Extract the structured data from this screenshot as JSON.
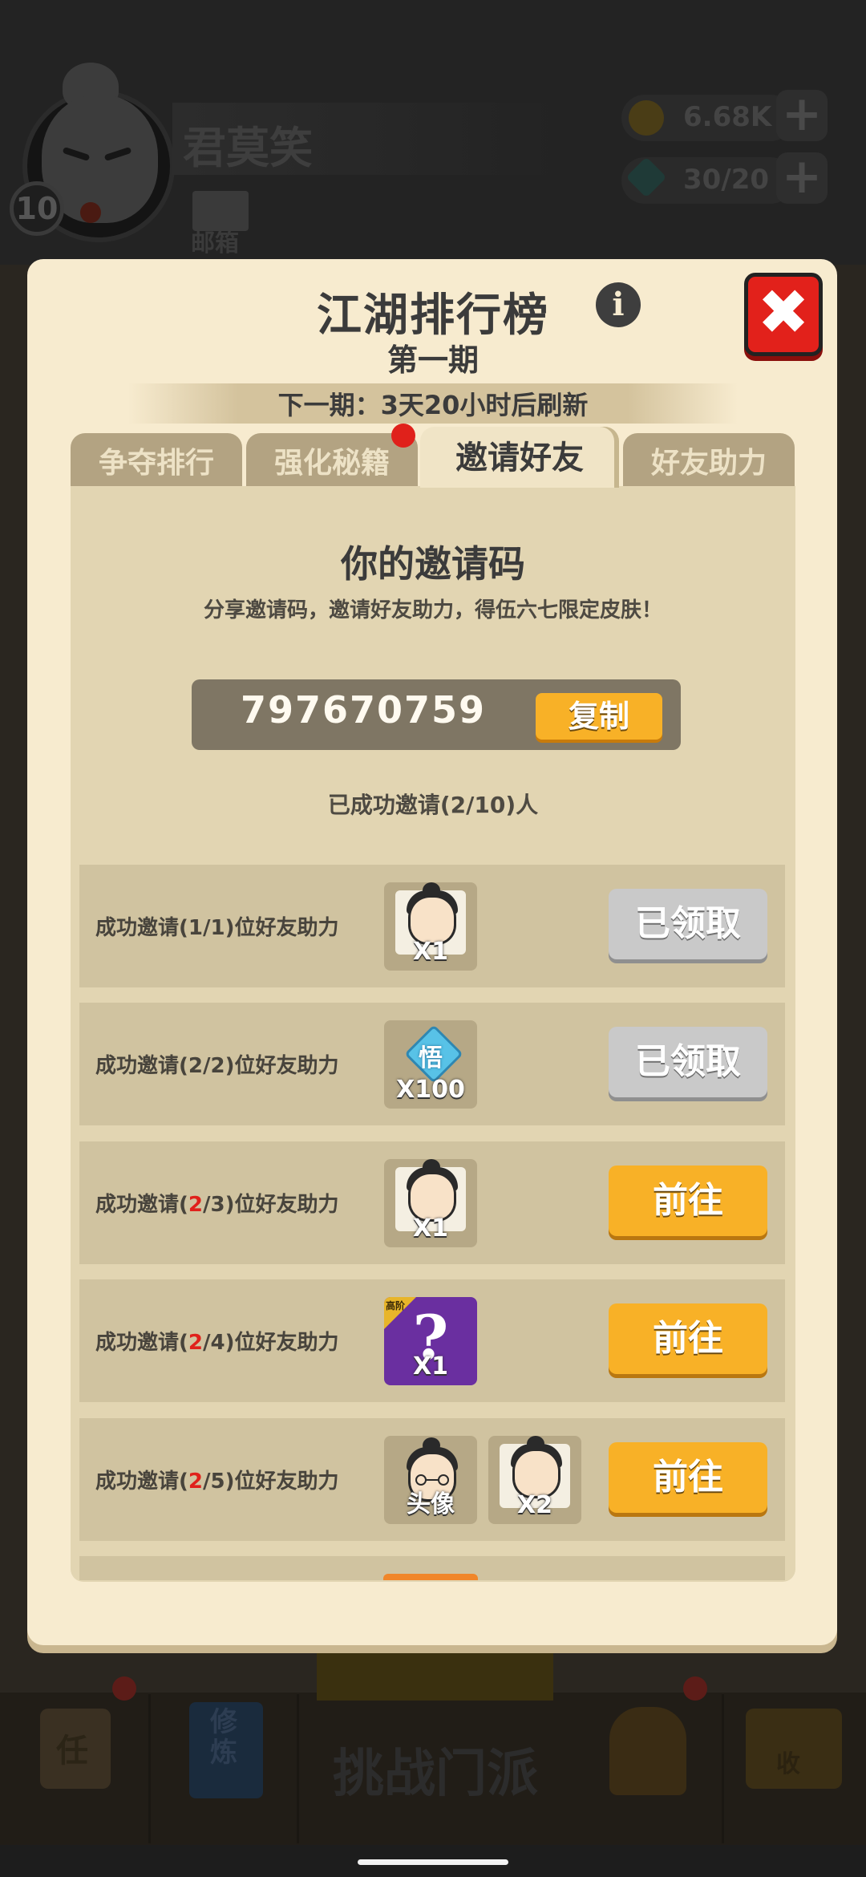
{
  "background": {
    "player": {
      "name": "君莫笑",
      "level": "10"
    },
    "mail_label": "邮箱",
    "resources": {
      "coins": "6.68K",
      "gems": "30/20"
    },
    "nav": {
      "task_char": "任",
      "book_chars": "修炼",
      "challenge_label": "挑战门派",
      "chest_char": "收"
    }
  },
  "modal": {
    "title": "江湖排行榜",
    "info_glyph": "i",
    "close_glyph": "✖",
    "subtitle": "第一期",
    "refresh_notice": "下一期：3天20小时后刷新",
    "tabs": [
      {
        "label": "争夺排行"
      },
      {
        "label": "强化秘籍"
      },
      {
        "label": "邀请好友"
      },
      {
        "label": "好友助力"
      }
    ],
    "active_tab": "邀请好友"
  },
  "invite": {
    "heading": "你的邀请码",
    "description": "分享邀请码，邀请好友助力，得伍六七限定皮肤！",
    "code": "797670759",
    "copy_label": "复制",
    "status": "已成功邀请(2/10)人"
  },
  "rewards": [
    {
      "prefix": "成功邀请(",
      "progress": "1",
      "goal": "/1)位好友助力",
      "highlight": false,
      "items": [
        {
          "icon": "character-fragment-icon",
          "qty": "X1"
        }
      ],
      "button": "已领取",
      "state": "claimed"
    },
    {
      "prefix": "成功邀请(",
      "progress": "2",
      "goal": "/2)位好友助力",
      "highlight": false,
      "items": [
        {
          "icon": "enlightenment-gem-icon",
          "glyph": "悟",
          "qty": "X100"
        }
      ],
      "button": "已领取",
      "state": "claimed"
    },
    {
      "prefix": "成功邀请(",
      "progress": "2",
      "goal": "/3)位好友助力",
      "highlight": true,
      "items": [
        {
          "icon": "character-fragment-icon",
          "qty": "X1"
        }
      ],
      "button": "前往",
      "state": "go"
    },
    {
      "prefix": "成功邀请(",
      "progress": "2",
      "goal": "/4)位好友助力",
      "highlight": true,
      "items": [
        {
          "icon": "mystery-box-icon",
          "tag": "高阶",
          "glyph": "?",
          "qty": "X1"
        }
      ],
      "button": "前往",
      "state": "go"
    },
    {
      "prefix": "成功邀请(",
      "progress": "2",
      "goal": "/5)位好友助力",
      "highlight": true,
      "items": [
        {
          "icon": "avatar-portrait-icon",
          "qty": "头像"
        },
        {
          "icon": "character-fragment-icon",
          "qty": "X2"
        }
      ],
      "button": "前往",
      "state": "go"
    }
  ],
  "colors": {
    "accent": "#f8b127",
    "danger": "#e2211b",
    "modal_bg": "#f7ebcf",
    "panel_bg": "#e2d5b2",
    "highlight_text": "#e0211b"
  }
}
